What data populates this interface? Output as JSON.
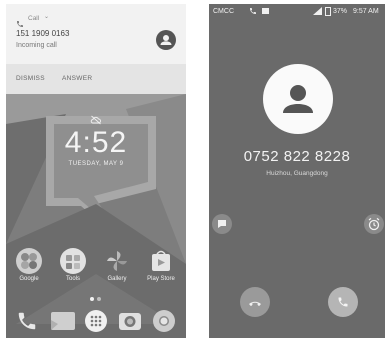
{
  "left_phone": {
    "notification": {
      "app_label": "Call",
      "caller_number": "151 1909 0163",
      "call_state": "Incoming call",
      "actions": [
        "DISMISS",
        "ANSWER"
      ]
    },
    "lockscreen": {
      "time": "4:52",
      "date": "TUESDAY, MAY 9"
    },
    "apps": [
      {
        "label": "Google",
        "icon": "google-folder-icon"
      },
      {
        "label": "Tools",
        "icon": "tools-folder-icon"
      },
      {
        "label": "Gallery",
        "icon": "gallery-icon"
      },
      {
        "label": "Play Store",
        "icon": "play-store-icon"
      }
    ],
    "dock": [
      "phone-icon",
      "messages-icon",
      "app-drawer-icon",
      "camera-icon",
      "chrome-icon"
    ]
  },
  "right_phone": {
    "status_bar": {
      "carrier": "CMCC",
      "battery": "37%",
      "time": "9:57 AM"
    },
    "caller_number": "0752 822 8228",
    "caller_location": "Huizhou, Guangdong"
  },
  "colors": {
    "left_background": "#8e8e8e",
    "right_background": "#6a6a6a",
    "notification_background": "#f2f2f2"
  }
}
